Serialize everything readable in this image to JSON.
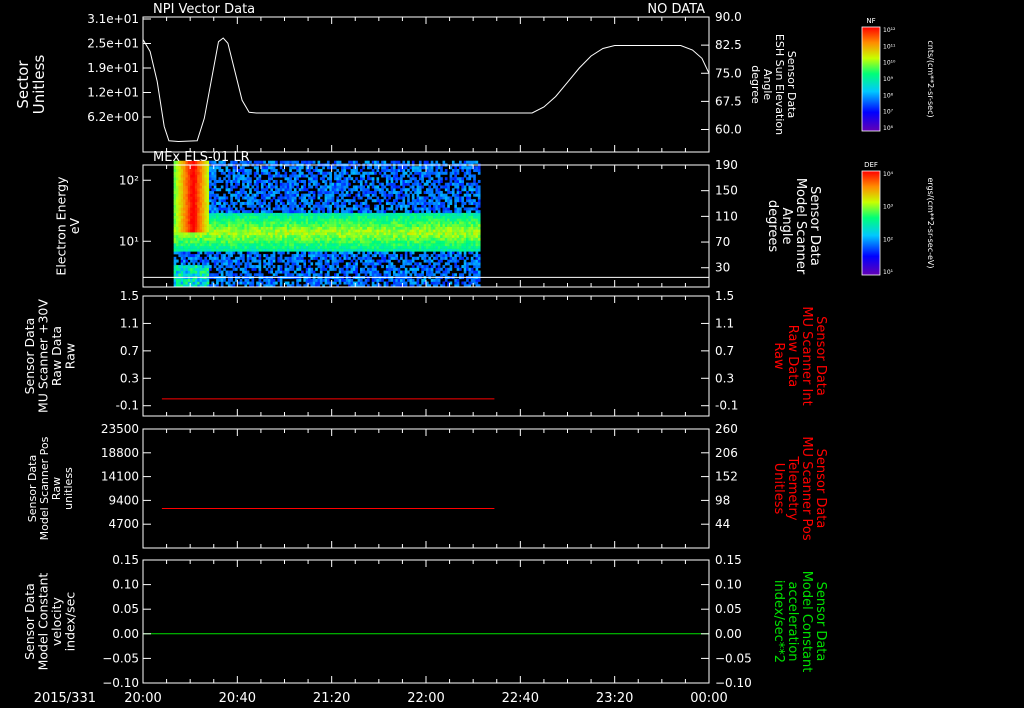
{
  "chart_data": {
    "type": "multi-panel-timeseries",
    "x_axis": {
      "date_label": "2015/331",
      "ticks": [
        "20:00",
        "20:40",
        "21:20",
        "22:00",
        "22:40",
        "23:20",
        "00:00"
      ],
      "range_minutes": [
        0,
        240
      ]
    },
    "panels": [
      {
        "id": "p1",
        "title_left": "NPI Vector Data",
        "title_right": "NO DATA",
        "ylabel_left": [
          "Sector",
          "Unitless"
        ],
        "left_ticks": [
          "3.1e+01",
          "2.5e+01",
          "1.9e+01",
          "1.2e+01",
          "6.2e+00"
        ],
        "ylabel_right": [
          "Sensor Data",
          "ESH Sun Elevation",
          "Angle",
          "degree"
        ],
        "right_ticks": [
          "90.0",
          "82.5",
          "75.0",
          "67.5",
          "60.0"
        ],
        "right_range": [
          54,
          90
        ],
        "series": [
          {
            "color": "#ffffff",
            "x": [
              0,
              3,
              6,
              9,
              11,
              15,
              23,
              26,
              32,
              34,
              36,
              39,
              42,
              45,
              48,
              120,
              165,
              170,
              175,
              180,
              185,
              190,
              195,
              200,
              215,
              228,
              233,
              237,
              240
            ],
            "y": [
              84,
              80.8,
              72.8,
              60.8,
              57.0,
              56.8,
              57.0,
              63.0,
              83.4,
              84.4,
              83.0,
              75.4,
              67.8,
              64.6,
              64.4,
              64.4,
              64.4,
              66.0,
              68.8,
              72.6,
              76.4,
              79.6,
              81.6,
              82.4,
              82.4,
              82.4,
              81.2,
              79.0,
              75.0
            ]
          }
        ]
      },
      {
        "id": "p2",
        "title_left": "MEx ELS-01 LR",
        "ylabel_left": [
          "Electron Energy",
          "eV"
        ],
        "left_ticks": [
          "10²",
          "10¹"
        ],
        "left_log_range": [
          0.25,
          2.25
        ],
        "ylabel_right": [
          "Sensor Data",
          "Model Scanner",
          "Angle",
          "degrees"
        ],
        "right_ticks": [
          "190",
          "150",
          "110",
          "70",
          "30"
        ],
        "right_range": [
          0,
          190
        ],
        "spectrogram": {
          "x_range_minutes": [
            13,
            143
          ],
          "min_log": 0.25,
          "max_log": 2.28,
          "core_log_range": [
            0.8,
            1.45
          ],
          "burst_x_range_minutes": [
            13,
            27
          ]
        },
        "series": [
          {
            "color": "#ffffff",
            "x": [
              0,
              240
            ],
            "y": [
              15,
              15
            ]
          }
        ]
      },
      {
        "id": "p3",
        "ylabel_left": [
          "Sensor Data",
          "MU Scanner +30V",
          "Raw Data",
          "Raw"
        ],
        "left_ticks": [
          "1.5",
          "1.1",
          "0.7",
          "0.3",
          "-0.1"
        ],
        "left_range": [
          -0.25,
          1.5
        ],
        "ylabel_right": [
          "Sensor Data",
          "MU Scanner Int",
          "Raw Data",
          "Raw"
        ],
        "right_ticks": [
          "1.5",
          "1.1",
          "0.7",
          "0.3",
          "-0.1"
        ],
        "right_color": "#ff0000",
        "series": [
          {
            "color": "#ff0000",
            "x": [
              8,
              149
            ],
            "y": [
              0.0,
              0.0
            ]
          }
        ]
      },
      {
        "id": "p4",
        "ylabel_left": [
          "Sensor Data",
          "Model Scanner Pos",
          "Raw",
          "unitless"
        ],
        "left_ticks": [
          "23500",
          "18800",
          "14100",
          "9400",
          "4700"
        ],
        "left_range": [
          0,
          23500
        ],
        "ylabel_right": [
          "Sensor Data",
          "MU Scanner Pos",
          "Telemetry",
          "Unitless"
        ],
        "right_ticks": [
          "260",
          "206",
          "152",
          "98",
          "44"
        ],
        "right_color": "#ff0000",
        "series": [
          {
            "color": "#ff0000",
            "x": [
              8,
              149
            ],
            "y": [
              7800,
              7800
            ]
          }
        ]
      },
      {
        "id": "p5",
        "ylabel_left": [
          "Sensor Data",
          "Model Constant",
          "velocity",
          "index/sec"
        ],
        "left_ticks": [
          "0.15",
          "0.10",
          "0.05",
          "0.00",
          "−0.05",
          "−0.10"
        ],
        "left_range": [
          -0.1,
          0.15
        ],
        "ylabel_right": [
          "Sensor Data",
          "Model Constant",
          "acceleration",
          "index/sec**2"
        ],
        "right_ticks": [
          "0.15",
          "0.10",
          "0.05",
          "0.00",
          "−0.05",
          "−0.10"
        ],
        "right_color": "#00e000",
        "series": [
          {
            "color": "#00e000",
            "x": [
              0,
              240
            ],
            "y": [
              0.0,
              0.0
            ]
          }
        ]
      }
    ],
    "colorbars": [
      {
        "id": "cb1",
        "title": "NF",
        "ticks": [
          "10¹²",
          "10¹¹",
          "10¹⁰",
          "10⁹",
          "10⁸",
          "10⁷",
          "10⁶"
        ],
        "unit": "cnts/(cm**2-sr-sec)"
      },
      {
        "id": "cb2",
        "title": "DEF",
        "ticks": [
          "10⁴",
          "10³",
          "10²",
          "10¹"
        ],
        "unit": "ergs/(cm**2-sr-sec-eV)"
      }
    ]
  }
}
